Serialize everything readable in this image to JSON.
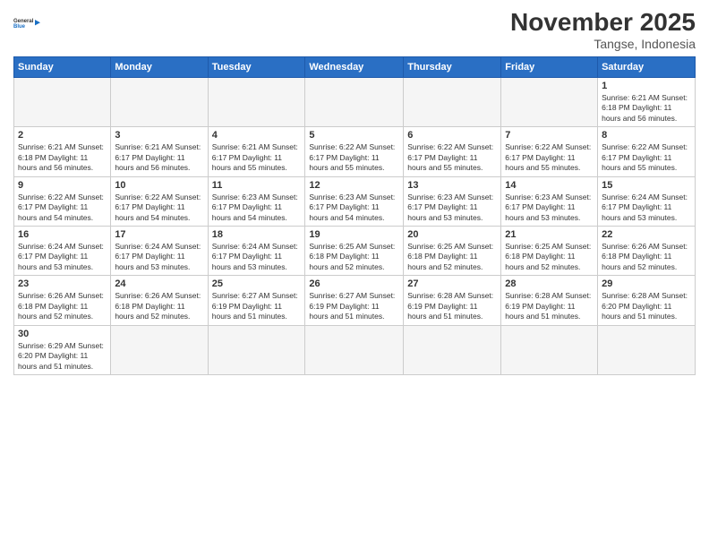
{
  "header": {
    "logo_general": "General",
    "logo_blue": "Blue",
    "month_title": "November 2025",
    "subtitle": "Tangse, Indonesia"
  },
  "days_of_week": [
    "Sunday",
    "Monday",
    "Tuesday",
    "Wednesday",
    "Thursday",
    "Friday",
    "Saturday"
  ],
  "weeks": [
    [
      {
        "num": "",
        "info": ""
      },
      {
        "num": "",
        "info": ""
      },
      {
        "num": "",
        "info": ""
      },
      {
        "num": "",
        "info": ""
      },
      {
        "num": "",
        "info": ""
      },
      {
        "num": "",
        "info": ""
      },
      {
        "num": "1",
        "info": "Sunrise: 6:21 AM\nSunset: 6:18 PM\nDaylight: 11 hours\nand 56 minutes."
      }
    ],
    [
      {
        "num": "2",
        "info": "Sunrise: 6:21 AM\nSunset: 6:18 PM\nDaylight: 11 hours\nand 56 minutes."
      },
      {
        "num": "3",
        "info": "Sunrise: 6:21 AM\nSunset: 6:17 PM\nDaylight: 11 hours\nand 56 minutes."
      },
      {
        "num": "4",
        "info": "Sunrise: 6:21 AM\nSunset: 6:17 PM\nDaylight: 11 hours\nand 55 minutes."
      },
      {
        "num": "5",
        "info": "Sunrise: 6:22 AM\nSunset: 6:17 PM\nDaylight: 11 hours\nand 55 minutes."
      },
      {
        "num": "6",
        "info": "Sunrise: 6:22 AM\nSunset: 6:17 PM\nDaylight: 11 hours\nand 55 minutes."
      },
      {
        "num": "7",
        "info": "Sunrise: 6:22 AM\nSunset: 6:17 PM\nDaylight: 11 hours\nand 55 minutes."
      },
      {
        "num": "8",
        "info": "Sunrise: 6:22 AM\nSunset: 6:17 PM\nDaylight: 11 hours\nand 55 minutes."
      }
    ],
    [
      {
        "num": "9",
        "info": "Sunrise: 6:22 AM\nSunset: 6:17 PM\nDaylight: 11 hours\nand 54 minutes."
      },
      {
        "num": "10",
        "info": "Sunrise: 6:22 AM\nSunset: 6:17 PM\nDaylight: 11 hours\nand 54 minutes."
      },
      {
        "num": "11",
        "info": "Sunrise: 6:23 AM\nSunset: 6:17 PM\nDaylight: 11 hours\nand 54 minutes."
      },
      {
        "num": "12",
        "info": "Sunrise: 6:23 AM\nSunset: 6:17 PM\nDaylight: 11 hours\nand 54 minutes."
      },
      {
        "num": "13",
        "info": "Sunrise: 6:23 AM\nSunset: 6:17 PM\nDaylight: 11 hours\nand 53 minutes."
      },
      {
        "num": "14",
        "info": "Sunrise: 6:23 AM\nSunset: 6:17 PM\nDaylight: 11 hours\nand 53 minutes."
      },
      {
        "num": "15",
        "info": "Sunrise: 6:24 AM\nSunset: 6:17 PM\nDaylight: 11 hours\nand 53 minutes."
      }
    ],
    [
      {
        "num": "16",
        "info": "Sunrise: 6:24 AM\nSunset: 6:17 PM\nDaylight: 11 hours\nand 53 minutes."
      },
      {
        "num": "17",
        "info": "Sunrise: 6:24 AM\nSunset: 6:17 PM\nDaylight: 11 hours\nand 53 minutes."
      },
      {
        "num": "18",
        "info": "Sunrise: 6:24 AM\nSunset: 6:17 PM\nDaylight: 11 hours\nand 53 minutes."
      },
      {
        "num": "19",
        "info": "Sunrise: 6:25 AM\nSunset: 6:18 PM\nDaylight: 11 hours\nand 52 minutes."
      },
      {
        "num": "20",
        "info": "Sunrise: 6:25 AM\nSunset: 6:18 PM\nDaylight: 11 hours\nand 52 minutes."
      },
      {
        "num": "21",
        "info": "Sunrise: 6:25 AM\nSunset: 6:18 PM\nDaylight: 11 hours\nand 52 minutes."
      },
      {
        "num": "22",
        "info": "Sunrise: 6:26 AM\nSunset: 6:18 PM\nDaylight: 11 hours\nand 52 minutes."
      }
    ],
    [
      {
        "num": "23",
        "info": "Sunrise: 6:26 AM\nSunset: 6:18 PM\nDaylight: 11 hours\nand 52 minutes."
      },
      {
        "num": "24",
        "info": "Sunrise: 6:26 AM\nSunset: 6:18 PM\nDaylight: 11 hours\nand 52 minutes."
      },
      {
        "num": "25",
        "info": "Sunrise: 6:27 AM\nSunset: 6:19 PM\nDaylight: 11 hours\nand 51 minutes."
      },
      {
        "num": "26",
        "info": "Sunrise: 6:27 AM\nSunset: 6:19 PM\nDaylight: 11 hours\nand 51 minutes."
      },
      {
        "num": "27",
        "info": "Sunrise: 6:28 AM\nSunset: 6:19 PM\nDaylight: 11 hours\nand 51 minutes."
      },
      {
        "num": "28",
        "info": "Sunrise: 6:28 AM\nSunset: 6:19 PM\nDaylight: 11 hours\nand 51 minutes."
      },
      {
        "num": "29",
        "info": "Sunrise: 6:28 AM\nSunset: 6:20 PM\nDaylight: 11 hours\nand 51 minutes."
      }
    ],
    [
      {
        "num": "30",
        "info": "Sunrise: 6:29 AM\nSunset: 6:20 PM\nDaylight: 11 hours\nand 51 minutes."
      },
      {
        "num": "",
        "info": ""
      },
      {
        "num": "",
        "info": ""
      },
      {
        "num": "",
        "info": ""
      },
      {
        "num": "",
        "info": ""
      },
      {
        "num": "",
        "info": ""
      },
      {
        "num": "",
        "info": ""
      }
    ]
  ]
}
